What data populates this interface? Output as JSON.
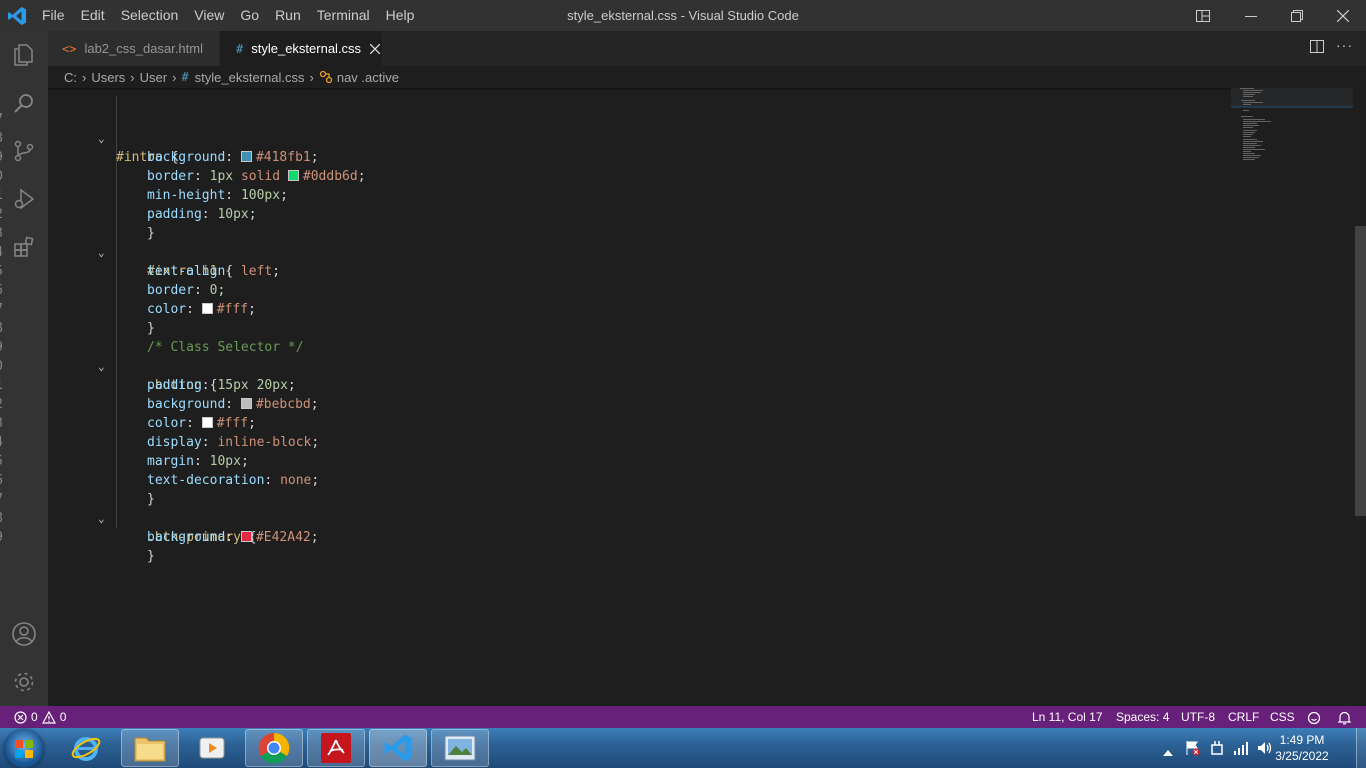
{
  "menu": [
    "File",
    "Edit",
    "Selection",
    "View",
    "Go",
    "Run",
    "Terminal",
    "Help"
  ],
  "window_title": "style_eksternal.css - Visual Studio Code",
  "tabs": [
    {
      "icon": "<>",
      "label": "lab2_css_dasar.html",
      "active": false
    },
    {
      "icon": "#",
      "label": "style_eksternal.css",
      "active": true
    }
  ],
  "breadcrumb": {
    "parts": [
      "C:",
      "Users",
      "User"
    ],
    "file_icon": "#",
    "file": "style_eksternal.css",
    "symbol": "nav .active"
  },
  "colors": {
    "accent": "#68217a",
    "swatch_1": "#418fb1",
    "swatch_2": "#0ddb6d",
    "swatch_white": "#ffffff",
    "swatch_grey": "#bebcbd",
    "swatch_red": "#E42A42"
  },
  "code": {
    "17": {
      "n": "17",
      "sel": "#intro",
      "brace": " {"
    },
    "18": {
      "n": "18",
      "prop": "background",
      "val": "#418fb1"
    },
    "19": {
      "n": "19",
      "prop": "border",
      "v1": "1px",
      "v2": "solid",
      "val": "#0ddb6d"
    },
    "20": {
      "n": "20",
      "prop": "min-height",
      "val": "100px"
    },
    "21": {
      "n": "21",
      "prop": "padding",
      "val": "10px"
    },
    "22": {
      "n": "22",
      "text": "}"
    },
    "23": {
      "n": "23",
      "sel": "#intro h1",
      "brace": " {"
    },
    "24": {
      "n": "24",
      "prop": "text-align",
      "val": "left"
    },
    "25": {
      "n": "25",
      "prop": "border",
      "val": "0"
    },
    "26": {
      "n": "26",
      "prop": "color",
      "val": "#fff"
    },
    "27": {
      "n": "27",
      "text": "}"
    },
    "28": {
      "n": "28",
      "text": "/* Class Selector */"
    },
    "29": {
      "n": "29",
      "sel": ".button",
      "brace": " {"
    },
    "30": {
      "n": "30",
      "prop": "padding",
      "val": "15px 20px"
    },
    "31": {
      "n": "31",
      "prop": "background",
      "val": "#bebcbd"
    },
    "32": {
      "n": "32",
      "prop": "color",
      "val": "#fff"
    },
    "33": {
      "n": "33",
      "prop": "display",
      "val": "inline-block"
    },
    "34": {
      "n": "34",
      "prop": "margin",
      "val": "10px"
    },
    "35": {
      "n": "35",
      "prop": "text-decoration",
      "val": "none"
    },
    "36": {
      "n": "36",
      "text": "}"
    },
    "37": {
      "n": "37",
      "sel": ".btn-primary",
      "brace": " {"
    },
    "38": {
      "n": "38",
      "prop": "background",
      "val": "#E42A42"
    },
    "39": {
      "n": "39",
      "text": "}"
    }
  },
  "status": {
    "errors": "0",
    "warnings": "0",
    "position": "Ln 11, Col 17",
    "spaces": "Spaces: 4",
    "encoding": "UTF-8",
    "eol": "CRLF",
    "language": "CSS"
  },
  "taskbar": {
    "time": "1:49 PM",
    "date": "3/25/2022"
  }
}
